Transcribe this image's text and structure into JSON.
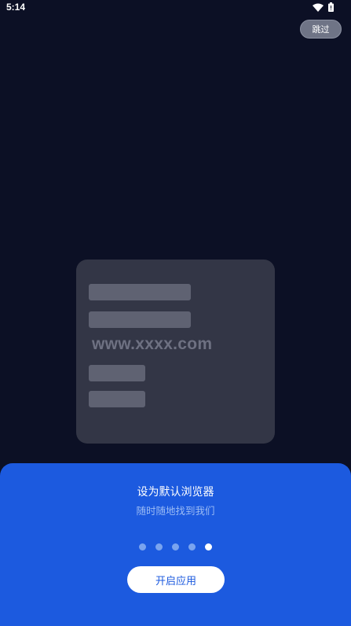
{
  "status_bar": {
    "time": "5:14",
    "icons": [
      "wifi-icon",
      "battery-icon"
    ]
  },
  "header": {
    "skip_label": "跳过"
  },
  "illustration": {
    "url_text": "www.xxxx.com"
  },
  "sheet": {
    "title": "设为默认浏览器",
    "subtitle": "随时随地找到我们",
    "page_count": 5,
    "active_page": 5,
    "start_label": "开启应用"
  },
  "colors": {
    "background": "#0c1025",
    "card": "#333646",
    "sheet": "#1c5adf",
    "accent_text": "#1c5adf"
  }
}
